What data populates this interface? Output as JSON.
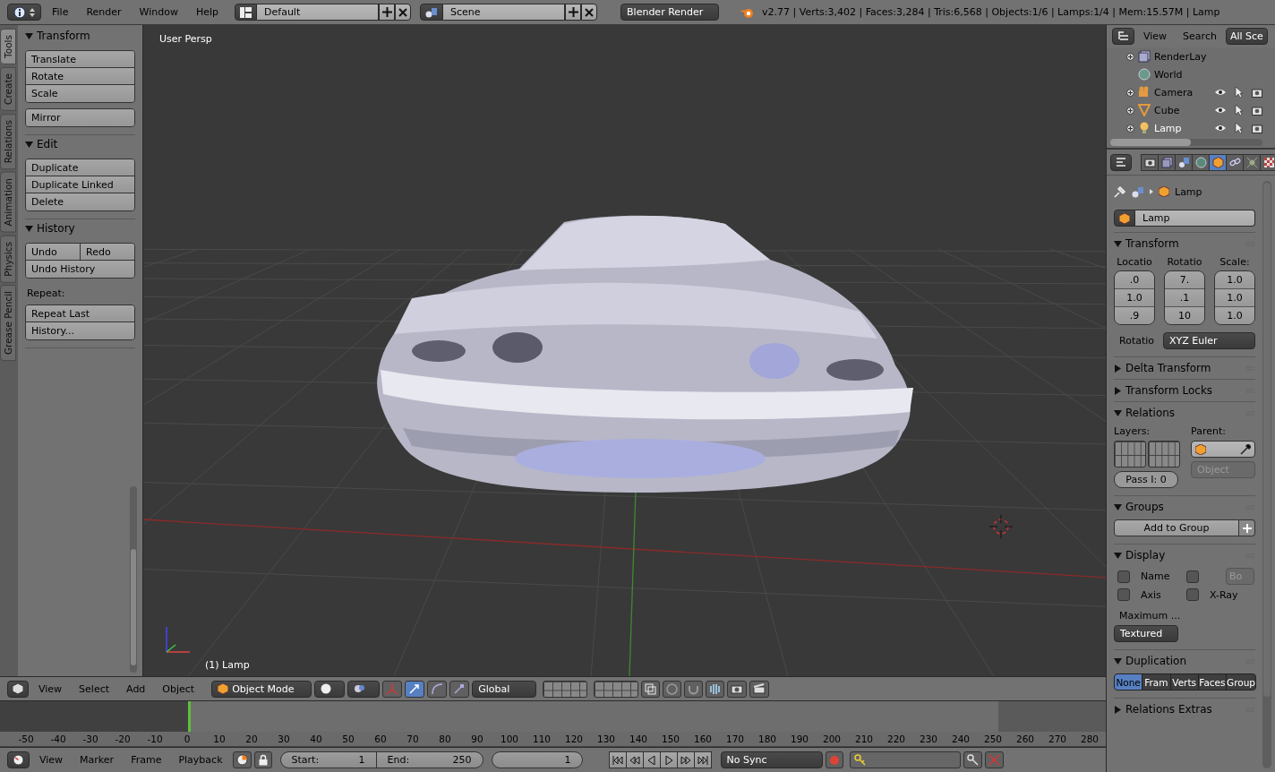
{
  "top_bar": {
    "menus": [
      "File",
      "Render",
      "Window",
      "Help"
    ],
    "screen_layout": "Default",
    "scene": "Scene",
    "render_engine": "Blender Render",
    "stats": "v2.77 | Verts:3,402 | Faces:3,284 | Tris:6,568 | Objects:1/6 | Lamps:1/4 | Mem:15.57M | Lamp"
  },
  "tool_tabs": [
    {
      "label": "Tools",
      "selected": true
    },
    {
      "label": "Create",
      "selected": false
    },
    {
      "label": "Relations",
      "selected": false
    },
    {
      "label": "Animation",
      "selected": false
    },
    {
      "label": "Physics",
      "selected": false
    },
    {
      "label": "Grease Pencil",
      "selected": false
    }
  ],
  "tool_panels": [
    {
      "title": "Transform",
      "expanded": true,
      "blocks": [
        {
          "kind": "buttons",
          "rows": [
            [
              "Translate"
            ],
            [
              "Rotate"
            ],
            [
              "Scale"
            ]
          ]
        },
        {
          "kind": "buttons",
          "rows": [
            [
              "Mirror"
            ]
          ]
        }
      ]
    },
    {
      "title": "Edit",
      "expanded": true,
      "blocks": [
        {
          "kind": "buttons",
          "rows": [
            [
              "Duplicate"
            ],
            [
              "Duplicate Linked"
            ],
            [
              "Delete"
            ]
          ]
        }
      ]
    },
    {
      "title": "History",
      "expanded": true,
      "blocks": [
        {
          "kind": "buttons",
          "rows": [
            [
              "Undo",
              "Redo"
            ],
            [
              "Undo History"
            ]
          ]
        },
        {
          "kind": "label",
          "text": "Repeat:"
        },
        {
          "kind": "buttons",
          "rows": [
            [
              "Repeat Last"
            ],
            [
              "History..."
            ]
          ]
        }
      ]
    }
  ],
  "viewport": {
    "view_label": "User Persp",
    "object_label": "(1) Lamp"
  },
  "viewport_header": {
    "menus": [
      "View",
      "Select",
      "Add",
      "Object"
    ],
    "mode": "Object Mode",
    "orientation": "Global"
  },
  "timeline": {
    "ruler": [
      "-50",
      "-40",
      "-30",
      "-20",
      "-10",
      "0",
      "10",
      "20",
      "30",
      "40",
      "50",
      "60",
      "70",
      "80",
      "90",
      "100",
      "110",
      "120",
      "130",
      "140",
      "150",
      "160",
      "170",
      "180",
      "190",
      "200",
      "210",
      "220",
      "230",
      "240",
      "250",
      "260",
      "270",
      "280"
    ],
    "menus": [
      "View",
      "Marker",
      "Frame",
      "Playback"
    ],
    "start": {
      "label": "Start:",
      "value": "1"
    },
    "end": {
      "label": "End:",
      "value": "250"
    },
    "current_frame": "1",
    "sync": "No Sync"
  },
  "outliner": {
    "menus": [
      "View",
      "Search"
    ],
    "display_mode": "All Sce",
    "items": [
      {
        "name": "RenderLay",
        "kind": "renderlayer",
        "expanded": false,
        "selected": false
      },
      {
        "name": "World",
        "kind": "world",
        "selected": false
      },
      {
        "name": "Camera",
        "kind": "camera",
        "expanded": false,
        "selected": false
      },
      {
        "name": "Cube",
        "kind": "mesh",
        "expanded": false,
        "selected": false
      },
      {
        "name": "Lamp",
        "kind": "lamp",
        "expanded": false,
        "selected": true
      }
    ]
  },
  "properties": {
    "context_tabs": [
      {
        "kind": "render",
        "selected": false
      },
      {
        "kind": "layers",
        "selected": false
      },
      {
        "kind": "scene",
        "selected": false
      },
      {
        "kind": "world",
        "selected": false
      },
      {
        "kind": "object",
        "selected": true
      },
      {
        "kind": "constraints",
        "selected": false
      },
      {
        "kind": "physics",
        "selected": false
      },
      {
        "kind": "texture",
        "selected": false
      }
    ],
    "breadcrumb": "Lamp",
    "object_name": "Lamp",
    "panels": [
      {
        "kind": "transform",
        "title": "Transform",
        "expanded": true
      },
      {
        "kind": "plain",
        "title": "Delta Transform",
        "expanded": false
      },
      {
        "kind": "plain",
        "title": "Transform Locks",
        "expanded": false
      },
      {
        "kind": "relations",
        "title": "Relations",
        "expanded": true
      },
      {
        "kind": "groups",
        "title": "Groups",
        "expanded": true
      },
      {
        "kind": "display",
        "title": "Display",
        "expanded": true
      },
      {
        "kind": "duplication",
        "title": "Duplication",
        "expanded": true
      },
      {
        "kind": "plain",
        "title": "Relations Extras",
        "expanded": false
      }
    ],
    "transform": {
      "columns": [
        {
          "label": "Locatio",
          "values": [
            ".0",
            "1.0",
            ".9"
          ]
        },
        {
          "label": "Rotatio",
          "values": [
            "7.",
            ".1",
            "10"
          ]
        },
        {
          "label": "Scale:",
          "values": [
            "1.0",
            "1.0",
            "1.0"
          ]
        }
      ],
      "rotation_mode_label": "Rotatio",
      "rotation_mode": "XYZ Euler"
    },
    "relations": {
      "layers_label": "Layers:",
      "parent_label": "Parent:",
      "parent_type": "Object",
      "pass_index": "Pass I: 0"
    },
    "groups": {
      "add_button": "Add to Group"
    },
    "display": {
      "name": {
        "label": "Name",
        "checked": false
      },
      "bounds": {
        "checked": false,
        "type": "Bo"
      },
      "axis": {
        "label": "Axis",
        "checked": false
      },
      "xray": {
        "label": "X-Ray",
        "checked": false
      },
      "max_draw_label": "Maximum ...",
      "max_draw_type": "Textured"
    },
    "duplication": {
      "options": [
        {
          "label": "None",
          "selected": true
        },
        {
          "label": "Fram",
          "selected": false
        },
        {
          "label": "Verts",
          "selected": false
        },
        {
          "label": "Faces",
          "selected": false
        },
        {
          "label": "Group",
          "selected": false
        }
      ]
    }
  }
}
